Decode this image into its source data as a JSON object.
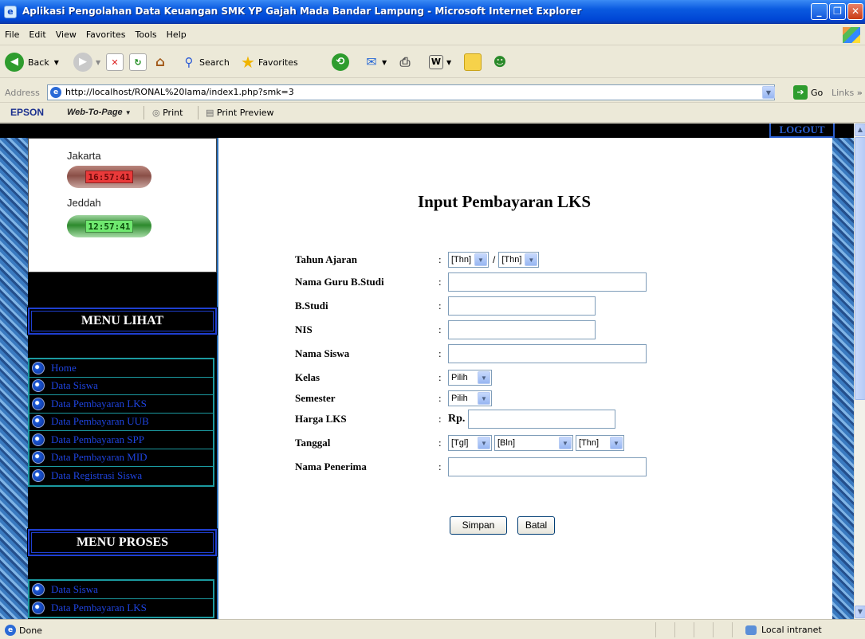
{
  "window": {
    "title": "Aplikasi Pengolahan Data Keuangan SMK YP Gajah Mada Bandar Lampung - Microsoft Internet Explorer"
  },
  "menubar": [
    "File",
    "Edit",
    "View",
    "Favorites",
    "Tools",
    "Help"
  ],
  "toolbar": {
    "back": "Back",
    "search": "Search",
    "favorites": "Favorites"
  },
  "address": {
    "label": "Address",
    "url": "http://localhost/RONAL%20lama/index1.php?smk=3",
    "go": "Go",
    "links": "Links"
  },
  "epson": {
    "logo": "EPSON",
    "web_to_page": "Web-To-Page",
    "print": "Print",
    "print_preview": "Print Preview"
  },
  "header": {
    "logout": "LOGOUT"
  },
  "clocks": [
    {
      "city": "Jakarta",
      "time": "16:57:41",
      "color": "#e93a3a"
    },
    {
      "city": "Jeddah",
      "time": "12:57:41",
      "color": "#6fe86f"
    }
  ],
  "menu_lihat": {
    "title": "MENU LIHAT",
    "items": [
      "Home",
      "Data Siswa",
      "Data Pembayaran LKS",
      "Data Pembayaran UUB",
      "Data Pembayaran SPP",
      "Data Pembayaran MID",
      "Data Registrasi Siswa"
    ]
  },
  "menu_proses": {
    "title": "MENU PROSES",
    "items": [
      "Data Siswa",
      "Data Pembayaran LKS"
    ]
  },
  "form": {
    "title": "Input Pembayaran LKS",
    "labels": {
      "tahun_ajaran": "Tahun Ajaran",
      "nama_guru": "Nama Guru B.Studi",
      "bstudi": "B.Studi",
      "nis": "NIS",
      "nama_siswa": "Nama Siswa",
      "kelas": "Kelas",
      "semester": "Semester",
      "harga": "Harga LKS",
      "tanggal": "Tanggal",
      "penerima": "Nama Penerima"
    },
    "colon": ":",
    "slash": "/",
    "currency": "Rp.",
    "selects": {
      "thn": "[Thn]",
      "pilih": "Pilih",
      "tgl": "[Tgl]",
      "bln": "[Bln]"
    },
    "buttons": {
      "save": "Simpan",
      "cancel": "Batal"
    }
  },
  "status": {
    "text": "Done",
    "zone": "Local intranet"
  },
  "colors": {
    "titlebar": "#0a5ae0",
    "menu_link": "#1f44e0",
    "menu_border": "#1b9aa0",
    "menu_head_border": "#1f3fd1"
  }
}
